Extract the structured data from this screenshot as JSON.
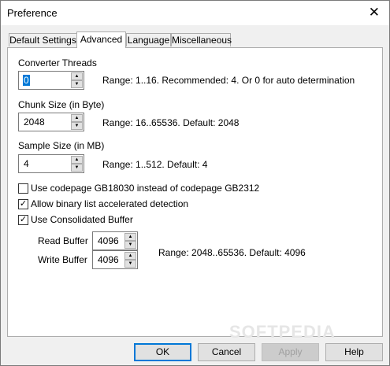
{
  "window": {
    "title": "Preference",
    "close_glyph": "✕"
  },
  "tabs": [
    {
      "label": "Default Settings"
    },
    {
      "label": "Advanced"
    },
    {
      "label": "Language"
    },
    {
      "label": "Miscellaneous"
    }
  ],
  "advanced": {
    "converter_threads": {
      "label": "Converter Threads",
      "value": "0",
      "hint": "Range: 1..16. Recommended: 4. Or 0 for auto determination"
    },
    "chunk_size": {
      "label": "Chunk Size (in Byte)",
      "value": "2048",
      "hint": "Range: 16..65536. Default: 2048"
    },
    "sample_size": {
      "label": "Sample Size (in MB)",
      "value": "4",
      "hint": "Range: 1..512. Default: 4"
    },
    "checkboxes": [
      {
        "label": "Use codepage GB18030 instead of codepage GB2312",
        "checked": false
      },
      {
        "label": "Allow binary list accelerated detection",
        "checked": true
      },
      {
        "label": "Use Consolidated Buffer",
        "checked": true
      }
    ],
    "read_buffer": {
      "label": "Read Buffer",
      "value": "4096"
    },
    "write_buffer": {
      "label": "Write Buffer",
      "value": "4096"
    },
    "buffer_hint": "Range: 2048..65536. Default: 4096"
  },
  "buttons": {
    "ok": "OK",
    "cancel": "Cancel",
    "apply": "Apply",
    "help": "Help"
  },
  "watermark": "SOFTPEDIA",
  "glyphs": {
    "up": "▲",
    "down": "▼",
    "check": "✓"
  },
  "colors": {
    "selection": "#0078d7",
    "default_button_border": "#0078d7"
  }
}
